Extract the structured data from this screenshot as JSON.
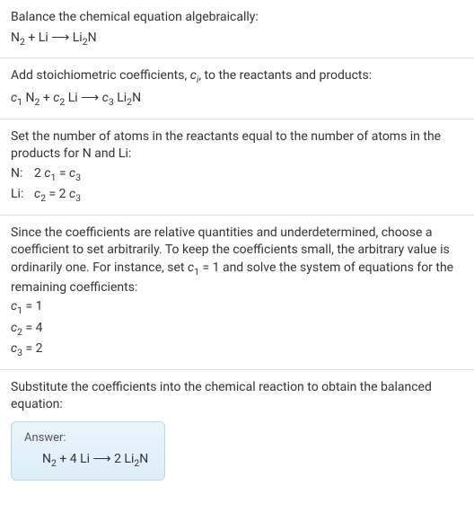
{
  "step1": {
    "title": "Balance the chemical equation algebraically:",
    "equation_reactants": "N",
    "equation_sub1": "2",
    "plus1": " + Li ⟶ Li",
    "equation_sub2": "2",
    "equation_end": "N"
  },
  "step2": {
    "title_part1": "Add stoichiometric coefficients, ",
    "title_var": "c",
    "title_sub": "i",
    "title_part2": ", to the reactants and products:",
    "c1": "c",
    "c1sub": "1",
    "sp1": " N",
    "n2sub": "2",
    "plus": " + ",
    "c2": "c",
    "c2sub": "2",
    "sp2": " Li ⟶ ",
    "c3": "c",
    "c3sub": "3",
    "sp3": " Li",
    "li2sub": "2",
    "end": "N"
  },
  "step3": {
    "title": "Set the number of atoms in the reactants equal to the number of atoms in the products for N and Li:",
    "n_label": "N:",
    "n_eq_pre": "2 ",
    "n_c1": "c",
    "n_c1sub": "1",
    "n_eq_mid": " = ",
    "n_c3": "c",
    "n_c3sub": "3",
    "li_label": "Li:",
    "li_c2": "c",
    "li_c2sub": "2",
    "li_eq_mid": " = 2 ",
    "li_c3": "c",
    "li_c3sub": "3"
  },
  "step4": {
    "title_part1": "Since the coefficients are relative quantities and underdetermined, choose a coefficient to set arbitrarily. To keep the coefficients small, the arbitrary value is ordinarily one. For instance, set ",
    "c1": "c",
    "c1sub": "1",
    "title_part2": " = 1 and solve the system of equations for the remaining coefficients:",
    "r1_c": "c",
    "r1_sub": "1",
    "r1_val": " = 1",
    "r2_c": "c",
    "r2_sub": "2",
    "r2_val": " = 4",
    "r3_c": "c",
    "r3_sub": "3",
    "r3_val": " = 2"
  },
  "step5": {
    "title": "Substitute the coefficients into the chemical reaction to obtain the balanced equation:",
    "answer_label": "Answer:",
    "ans_n": "N",
    "ans_n2sub": "2",
    "ans_mid": " + 4 Li ⟶ 2 Li",
    "ans_li2sub": "2",
    "ans_end": "N"
  }
}
